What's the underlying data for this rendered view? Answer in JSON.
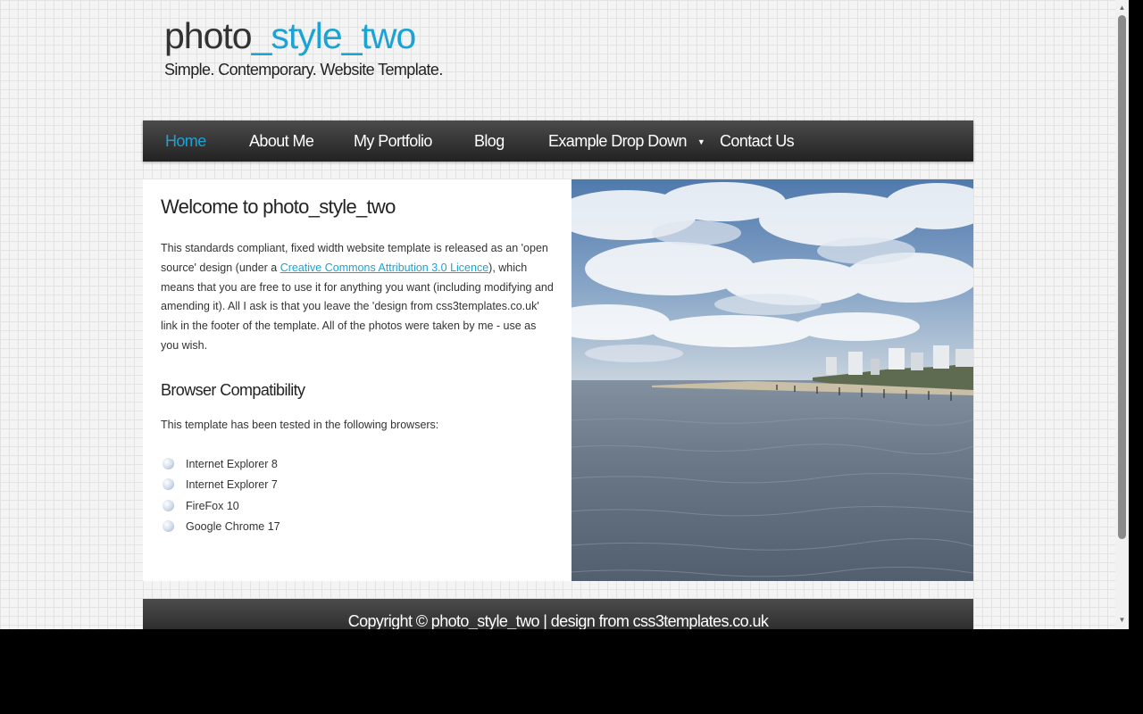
{
  "site": {
    "title_main": "photo",
    "title_accent": "_style_two",
    "slogan": "Simple. Contemporary. Website Template."
  },
  "menu": {
    "items": [
      {
        "label": "Home"
      },
      {
        "label": "About Me"
      },
      {
        "label": "My Portfolio"
      },
      {
        "label": "Blog"
      },
      {
        "label": "Example Drop Down"
      },
      {
        "label": "Contact Us"
      }
    ]
  },
  "content": {
    "heading": "Welcome to photo_style_two",
    "intro_before_link": "This standards compliant, fixed width website template is released as an 'open source' design (under a ",
    "intro_link": "Creative Commons Attribution 3.0 Licence",
    "intro_after_link": "), which means that you are free to use it for anything you want (including modifying and amending it). All I ask is that you leave the 'design from css3templates.co.uk' link in the footer of the template. All of the photos were taken by me - use as you wish.",
    "browser_heading": "Browser Compatibility",
    "browser_text": "This template has been tested in the following browsers:",
    "browsers": [
      "Internet Explorer 8",
      "Internet Explorer 7",
      "FireFox 10",
      "Google Chrome 17"
    ]
  },
  "footer": {
    "text": "Copyright © photo_style_two | design from css3templates.co.uk"
  },
  "colors": {
    "accent": "#1ba3d4",
    "menubar": "#2e2e2e",
    "page_bg": "#f4f4f4"
  },
  "icons": {
    "dropdown": "caret-down-icon",
    "list_bullet": "sphere-bullet-icon"
  }
}
